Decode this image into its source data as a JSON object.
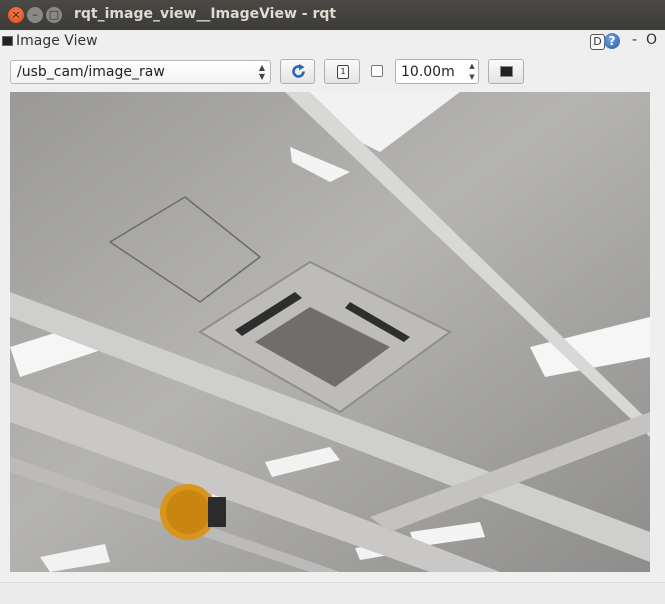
{
  "window": {
    "title": "rqt_image_view__ImageView - rqt",
    "close_glyph": "×",
    "minimize_glyph": "–",
    "maximize_glyph": "□"
  },
  "dock": {
    "title": "Image View",
    "d_label": "D",
    "help_label": "?",
    "minimize_label": "-",
    "close_label": "O"
  },
  "toolbar": {
    "topic": "/usb_cam/image_raw",
    "combo_arrows": "▲\n▼",
    "refresh_icon": "refresh-icon",
    "pick_icon": "mouse-pick-icon",
    "pick_glyph": "⎕",
    "timeout_value": "10.00m",
    "spin_up": "▲",
    "spin_down": "▼",
    "save_icon": "save-image-icon",
    "checkbox_checked": false
  },
  "image": {
    "description_icon": "camera-frame-image"
  }
}
